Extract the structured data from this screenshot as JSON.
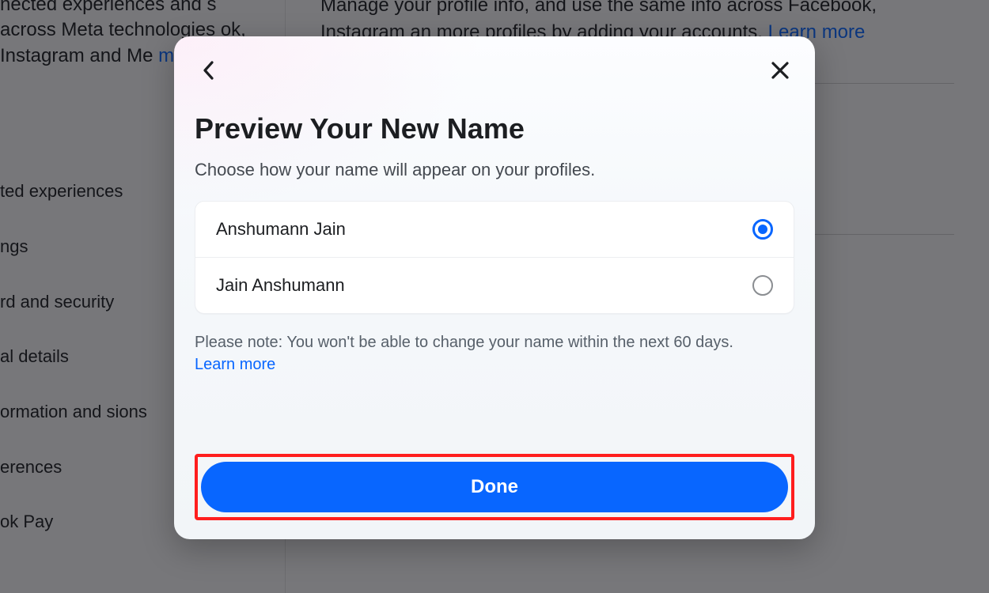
{
  "background": {
    "leftBlurb1": "nected experiences and s across Meta technologies ok, Instagram and Me",
    "leftLink": "more",
    "nav": [
      "ted experiences",
      "ngs",
      "rd and security",
      "al details",
      "ormation and sions",
      "erences",
      "ok Pay"
    ],
    "rightBlurb": "Manage your profile info, and use the same info across Facebook, Instagram an more profiles by adding your accounts. ",
    "rightLearn": "Learn more"
  },
  "modal": {
    "title": "Preview Your New Name",
    "subtitle": "Choose how your name will appear on your profiles.",
    "options": [
      {
        "label": "Anshumann Jain",
        "selected": true
      },
      {
        "label": "Jain Anshumann",
        "selected": false
      }
    ],
    "note": "Please note: You won't be able to change your name within the next 60 days. ",
    "noteLink": "Learn more",
    "doneLabel": "Done"
  }
}
